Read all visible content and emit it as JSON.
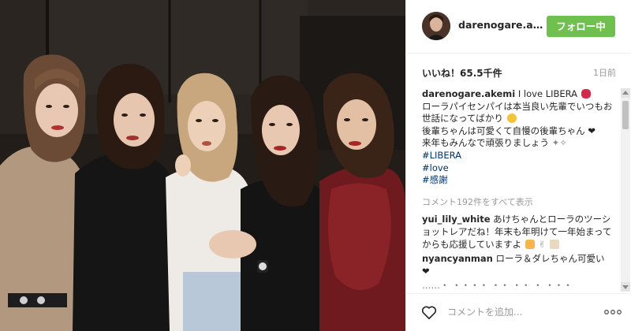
{
  "post": {
    "username": "darenogare.akemi",
    "follow_label": "フォロー中",
    "likes": "いいね！65.5千件",
    "time_ago": "1日前"
  },
  "caption": {
    "author": "darenogare.akemi",
    "text_1": "I love LIBERA",
    "text_2": "ローラパイセンパイは本当良い先輩でいつもお世話になってばかり",
    "text_3": "後輩ちゃんは可愛くて自慢の後輩ちゃん",
    "text_4": "来年もみんなで頑張りましょう",
    "hashtags": [
      "#LIBERA",
      "#love",
      "#感謝"
    ]
  },
  "view_all": "コメント192件をすべて表示",
  "comments": [
    {
      "author": "yui_lily_white",
      "text": "あけちゃんとローラのツーショットレアだね！年末も年明けて一年始まってからも応援していますよ"
    },
    {
      "author": "nyancyanman",
      "text": "ローラ＆ダレちゃん可愛い"
    },
    {
      "author": "",
      "text": "……・ ・・・・ ・・ ・・ ・ ・・・"
    }
  ],
  "footer": {
    "placeholder": "コメントを追加...",
    "more_label": "○○○"
  },
  "colors": {
    "follow_green": "#70c050",
    "hashtag_blue": "#003569",
    "meta_gray": "#999999"
  },
  "icons": [
    "avatar",
    "lips-emoji",
    "grimace-emoji",
    "heart-emoji",
    "sparkles-emoji",
    "cat-emoji",
    "heart-outline-icon",
    "more-options-icon"
  ]
}
